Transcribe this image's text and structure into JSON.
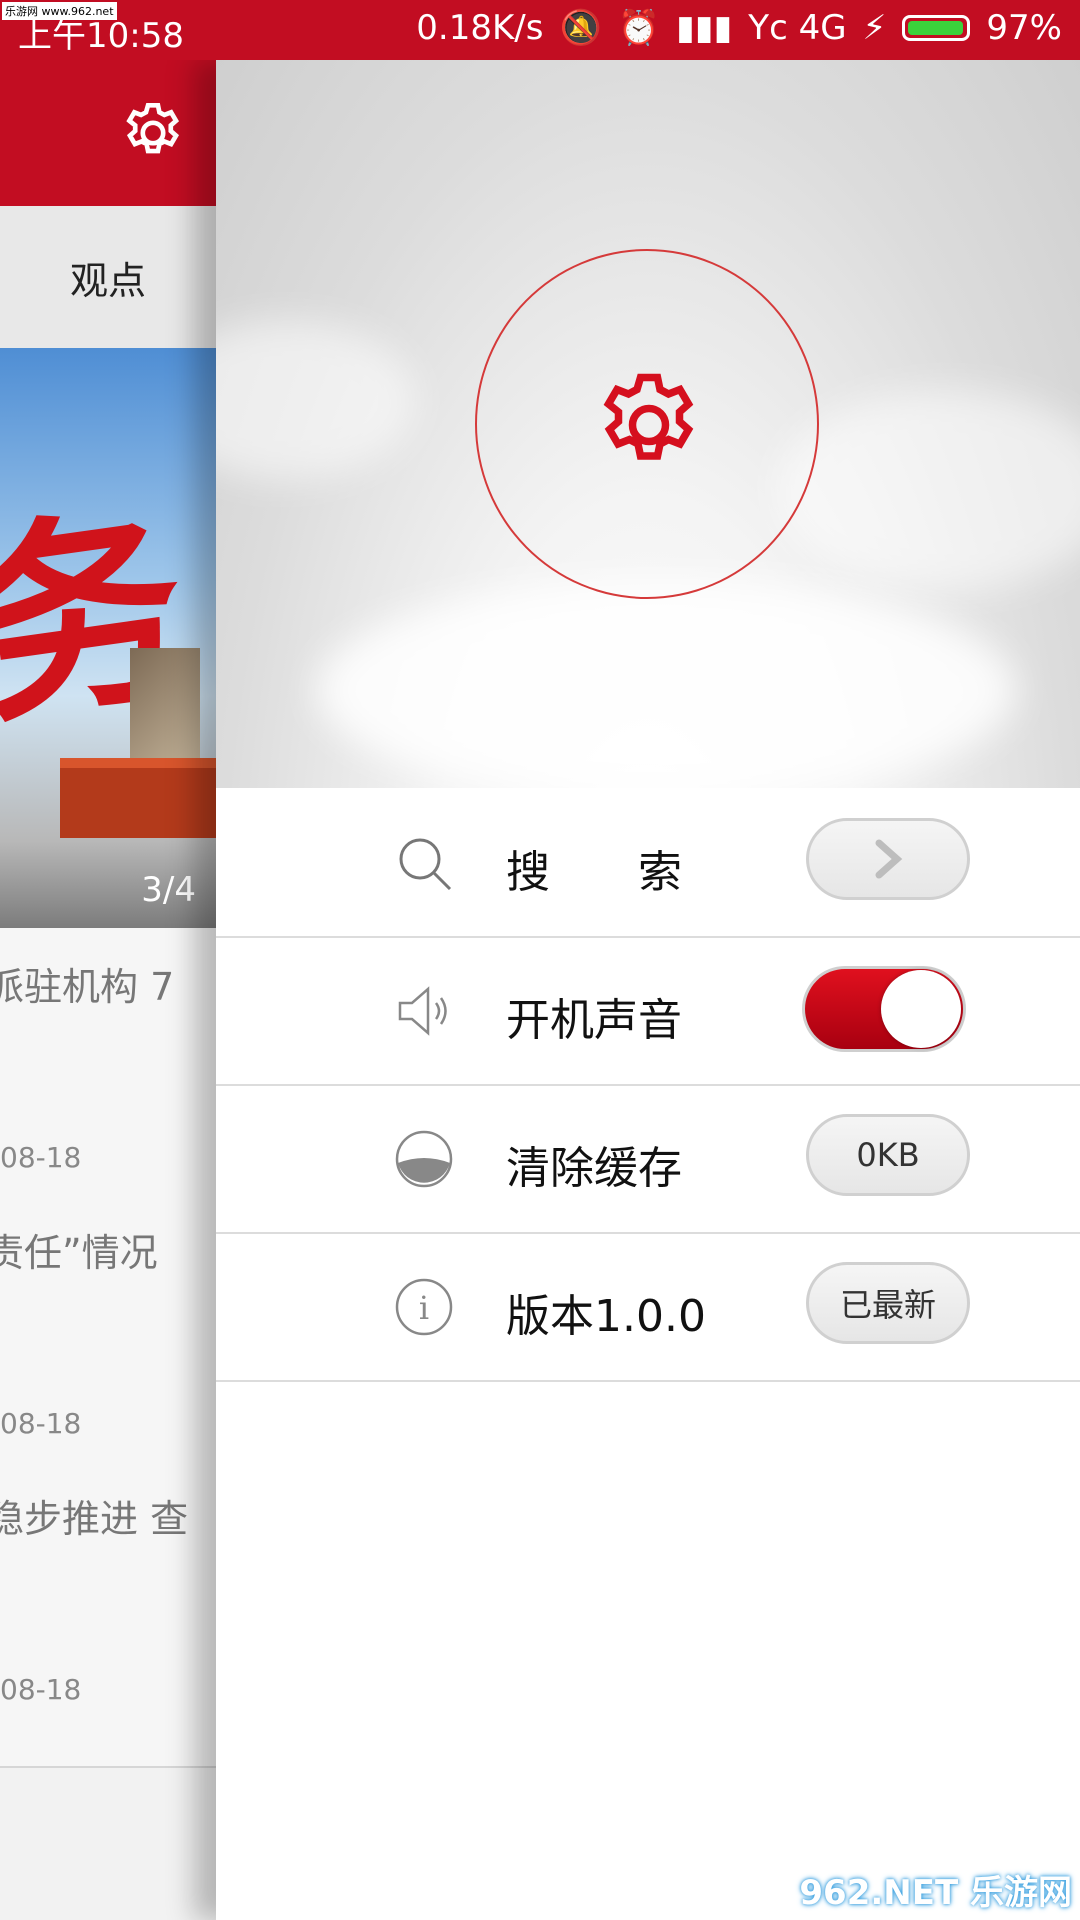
{
  "status_bar": {
    "time": "上午10:58",
    "speed": "0.18K/s",
    "carrier": "Yc 4G",
    "battery": "97%",
    "watermark": "乐游网 www.962.net"
  },
  "left_panel": {
    "tab_label": "观点",
    "banner_counter": "3/4",
    "news": [
      {
        "title": "派驻机构 7",
        "date": "08-18"
      },
      {
        "title": "责任”情况",
        "date": "08-18"
      },
      {
        "title": "稳步推进 查",
        "date": "08-18"
      }
    ]
  },
  "settings": {
    "search_label": "搜　　索",
    "sound_label": "开机声音",
    "sound_enabled": true,
    "cache_label": "清除缓存",
    "cache_value": "0KB",
    "version_label": "版本1.0.0",
    "version_status": "已最新"
  },
  "colors": {
    "brand_red": "#c20d22",
    "accent_red": "#d50f1e"
  },
  "watermark_bottom": "962.NET 乐游网"
}
